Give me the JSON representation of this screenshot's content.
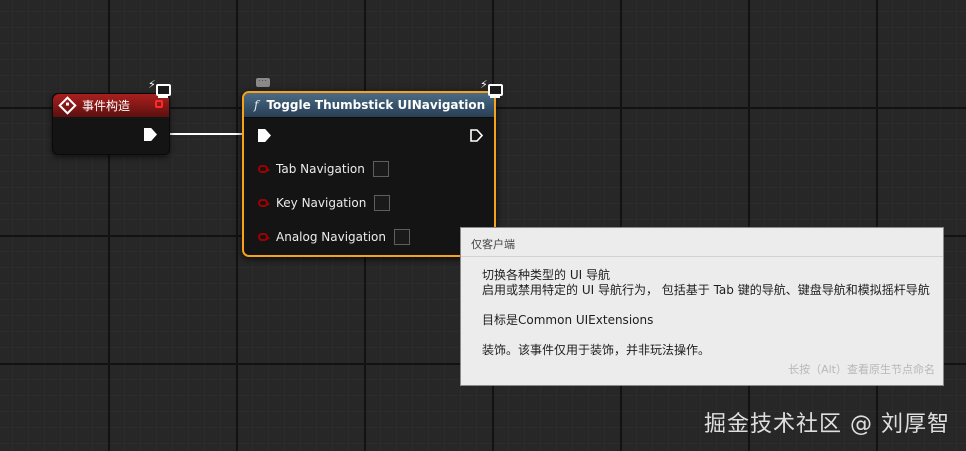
{
  "event_node": {
    "title": "事件构造"
  },
  "function_node": {
    "title": "Toggle Thumbstick UINavigation",
    "title_icon": "function-f-icon",
    "pins": [
      {
        "label": "Tab Navigation",
        "checked": false
      },
      {
        "label": "Key Navigation",
        "checked": false
      },
      {
        "label": "Analog Navigation",
        "checked": false
      }
    ]
  },
  "tooltip": {
    "header": "仅客户端",
    "lines": [
      "切换各种类型的 UI 导航",
      "启用或禁用特定的 UI 导航行为， 包括基于 Tab 键的导航、键盘导航和模拟摇杆导航",
      "目标是Common UIExtensions",
      "装饰。该事件仅用于装饰，并非玩法操作。"
    ],
    "hint": "长按（Alt）查看原生节点命名"
  },
  "watermark": "掘金技术社区 @ 刘厚智",
  "colors": {
    "selection_outline": "#f7a21b",
    "event_header": "#8b1a18",
    "function_header": "#3a5670",
    "bool_pin": "#a10000"
  }
}
